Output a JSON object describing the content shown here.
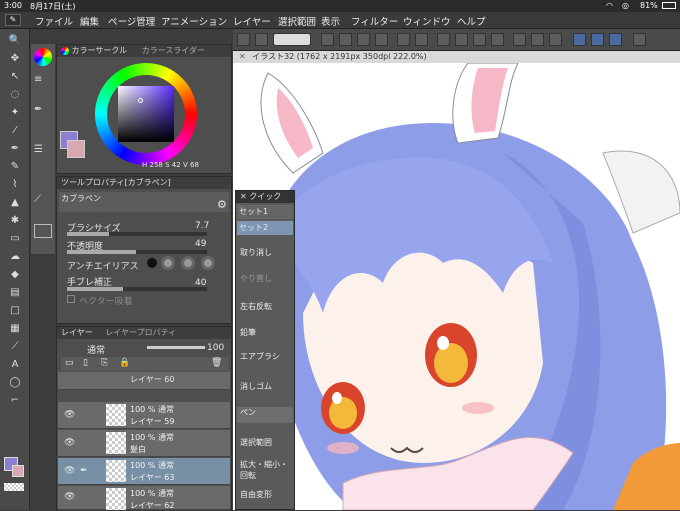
{
  "status": {
    "time": "3:00",
    "date": "8月17日(土)",
    "battery": "81%"
  },
  "menu": [
    "ファイル",
    "編集",
    "ページ管理",
    "アニメーション",
    "レイヤー",
    "選択範囲",
    "表示",
    "フィルター",
    "ウィンドウ",
    "ヘルプ"
  ],
  "color_panel": {
    "tab1": "カラーサークル",
    "tab2": "カラースライダー",
    "h": "258",
    "s": "42",
    "v": "68",
    "h_label": "H",
    "s_label": "S",
    "v_label": "V",
    "accent": "#8a7fd0"
  },
  "tool_props": {
    "title": "ツールプロパティ[カブラペン]",
    "pen_name": "カブラペン",
    "brush_size_label": "ブラシサイズ",
    "brush_size": "7.7",
    "opacity_label": "不透明度",
    "opacity": "49",
    "antialias_label": "アンチエイリアス",
    "stabilize_label": "手ブレ補正",
    "stabilize": "40",
    "vector_label": "ベクター吸着"
  },
  "canvas": {
    "title": "イラスト32 (1762 x 2191px 350dpi 222.0%)"
  },
  "quick": {
    "title": "クイック",
    "set1": "セット1",
    "set2": "セット2",
    "items": [
      "取り消し",
      "やり直し",
      "左右反転",
      "鉛筆",
      "エアブラシ",
      "消しゴム",
      "ペン",
      "選択範囲",
      "拡大・縮小・回転",
      "自由変形"
    ]
  },
  "layers": {
    "tab1": "レイヤー",
    "tab2": "レイヤープロパティ",
    "blend": "通常",
    "opacity": "100",
    "rows": [
      {
        "t1": "レイヤー 60",
        "t2": ""
      },
      {
        "t1": "100 % 通常",
        "t2": "レイヤー 59"
      },
      {
        "t1": "100 % 通常",
        "t2": "髪白"
      },
      {
        "t1": "100 % 通常",
        "t2": "レイヤー 63"
      },
      {
        "t1": "100 % 通常",
        "t2": "レイヤー 62"
      }
    ]
  }
}
